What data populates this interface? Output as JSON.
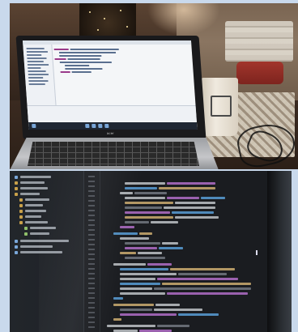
{
  "scene": {
    "description_tags": [
      "laptop",
      "code-editor",
      "coffee-cup",
      "quilting-fabric",
      "dark-ide"
    ],
    "colors": {
      "background": "#c9d9ec",
      "ide_background": "#1a1c20",
      "ide_sidebar": "#22262b",
      "keyword": "#c678dd",
      "string": "#e5c07b",
      "function": "#61afef",
      "plain": "#d6d9de",
      "comment": "#7f848e"
    }
  },
  "laptop": {
    "brand_text": "acer"
  },
  "icons": {
    "laptop": "laptop-icon",
    "cup": "cup-icon",
    "cables": "earbuds-icon",
    "text_cursor": "text-cursor-icon"
  }
}
